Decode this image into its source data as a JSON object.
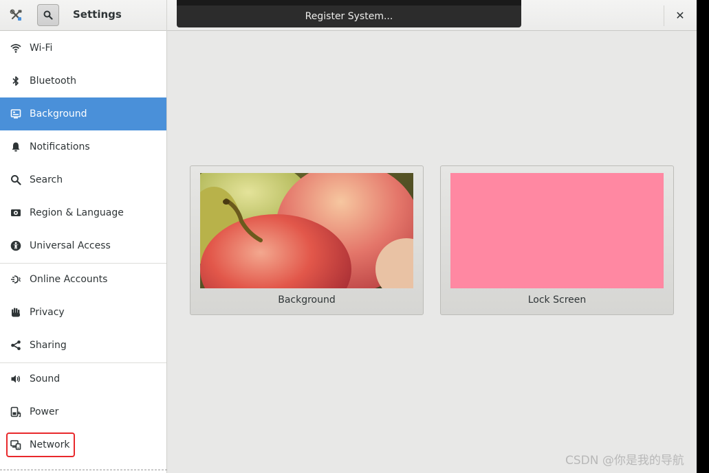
{
  "header": {
    "title": "Settings",
    "close_glyph": "✕"
  },
  "notification": {
    "text": "Register System..."
  },
  "sidebar": {
    "items": [
      {
        "label": "Wi-Fi",
        "icon": "wifi-icon"
      },
      {
        "label": "Bluetooth",
        "icon": "bluetooth-icon"
      },
      {
        "label": "Background",
        "icon": "background-icon",
        "selected": true
      },
      {
        "label": "Notifications",
        "icon": "bell-icon"
      },
      {
        "label": "Search",
        "icon": "search-icon"
      },
      {
        "label": "Region & Language",
        "icon": "region-icon"
      },
      {
        "label": "Universal Access",
        "icon": "accessibility-icon"
      },
      {
        "label": "Online Accounts",
        "icon": "online-accounts-icon"
      },
      {
        "label": "Privacy",
        "icon": "hand-icon"
      },
      {
        "label": "Sharing",
        "icon": "share-icon"
      },
      {
        "label": "Sound",
        "icon": "speaker-icon"
      },
      {
        "label": "Power",
        "icon": "power-icon"
      },
      {
        "label": "Network",
        "icon": "network-icon"
      }
    ]
  },
  "main": {
    "cards": [
      {
        "label": "Background"
      },
      {
        "label": "Lock Screen"
      }
    ]
  },
  "watermark": "CSDN @你是我的导航",
  "colors": {
    "selection": "#4a90d9",
    "lock_screen": "#ff88a2",
    "annotation_box": "#e8282b"
  }
}
